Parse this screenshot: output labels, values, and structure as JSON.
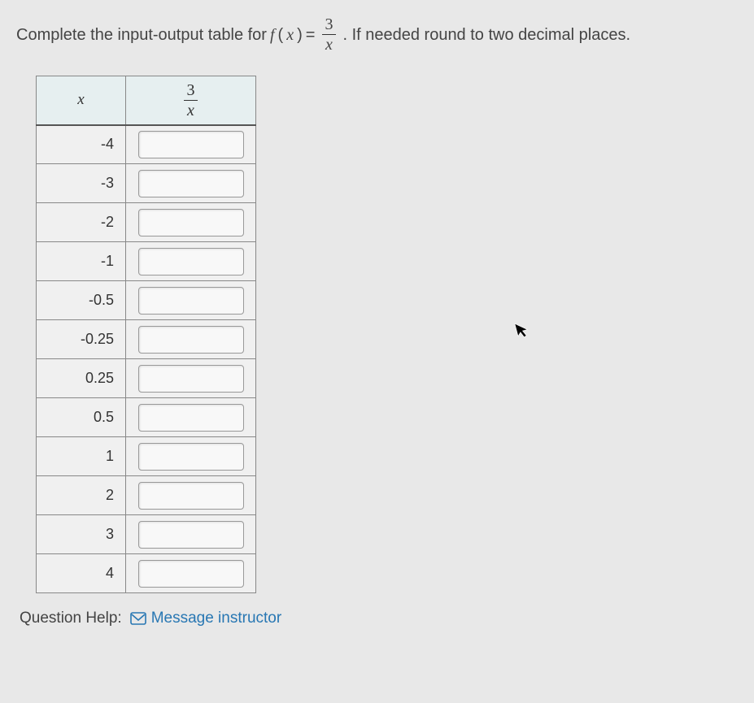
{
  "prompt": {
    "part1": "Complete the input-output table for ",
    "func_left": "f",
    "func_var": "x",
    "equals": " = ",
    "frac_num": "3",
    "frac_den": "x",
    "part2": ". If needed round to two decimal places."
  },
  "table": {
    "header_x": "x",
    "header_frac_num": "3",
    "header_frac_den": "x",
    "rows": [
      {
        "x": "-4",
        "fx": ""
      },
      {
        "x": "-3",
        "fx": ""
      },
      {
        "x": "-2",
        "fx": ""
      },
      {
        "x": "-1",
        "fx": ""
      },
      {
        "x": "-0.5",
        "fx": ""
      },
      {
        "x": "-0.25",
        "fx": ""
      },
      {
        "x": "0.25",
        "fx": ""
      },
      {
        "x": "0.5",
        "fx": ""
      },
      {
        "x": "1",
        "fx": ""
      },
      {
        "x": "2",
        "fx": ""
      },
      {
        "x": "3",
        "fx": ""
      },
      {
        "x": "4",
        "fx": ""
      }
    ]
  },
  "help": {
    "label": "Question Help:",
    "link": "Message instructor"
  }
}
